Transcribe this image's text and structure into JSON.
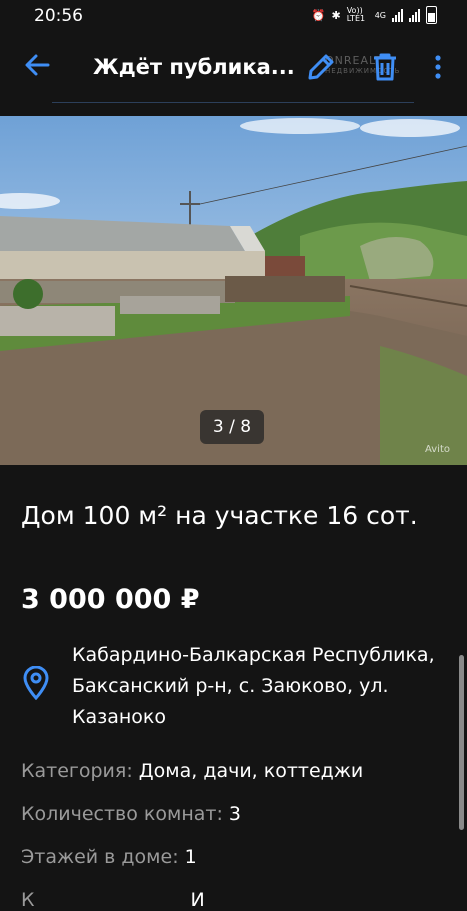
{
  "status_bar": {
    "time": "20:56",
    "network_label_top": "Vo)) LTE1",
    "network_label_4g": "4G"
  },
  "appbar": {
    "title": "Ждёт публика...",
    "back_icon": "arrow-left-icon",
    "edit_icon": "pencil-icon",
    "delete_icon": "trash-icon",
    "more_icon": "more-vert-icon",
    "accent": "#3f8ef5"
  },
  "watermark": {
    "brand": "ONREALT",
    "sub": "НЕДВИЖИМОСТЬ"
  },
  "gallery": {
    "counter": "3 / 8",
    "photo_credit": "Avito"
  },
  "listing": {
    "title": "Дом 100 м² на участке 16 сот.",
    "price": "3 000 000 ₽",
    "address": "Кабардино-Балкарская Республика, Баксанский р-н, с. Заюково, ул. Казаноко",
    "params": [
      {
        "key": "Категория:",
        "value": "Дома, дачи, коттеджи"
      },
      {
        "key": "Количество комнат:",
        "value": "3"
      },
      {
        "key": "Этажей в доме:",
        "value": "1"
      },
      {
        "key": "К",
        "value": "И"
      }
    ]
  }
}
